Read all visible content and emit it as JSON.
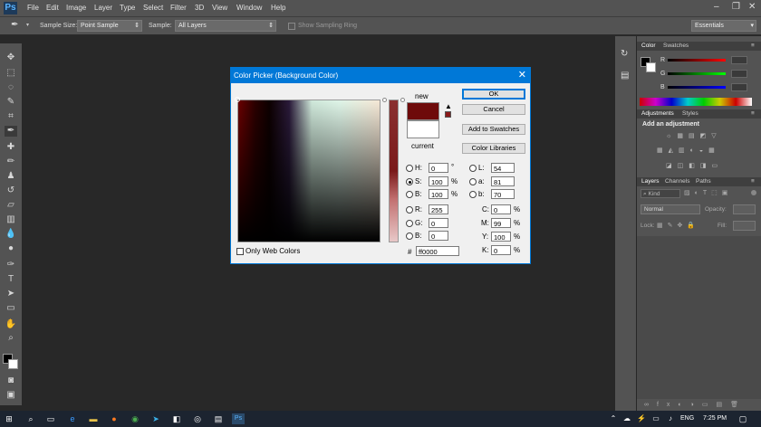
{
  "menubar": {
    "logo": "Ps",
    "items": [
      "File",
      "Edit",
      "Image",
      "Layer",
      "Type",
      "Select",
      "Filter",
      "3D",
      "View",
      "Window",
      "Help"
    ]
  },
  "options_bar": {
    "sample_size_label": "Sample Size:",
    "sample_size_value": "Point Sample",
    "sample_label": "Sample:",
    "sample_value": "All Layers",
    "show_ring_label": "Show Sampling Ring",
    "workspace_value": "Essentials"
  },
  "panels": {
    "color_tabs": [
      "Color",
      "Swatches"
    ],
    "color_channels": [
      "R",
      "G",
      "B"
    ],
    "adjust_tabs": [
      "Adjustments",
      "Styles"
    ],
    "add_adjustment": "Add an adjustment",
    "layers_tabs": [
      "Layers",
      "Channels",
      "Paths"
    ],
    "kind_label": "Kind",
    "blend_mode": "Normal",
    "opacity_label": "Opacity:",
    "lock_label": "Lock:",
    "fill_label": "Fill:"
  },
  "dialog": {
    "title": "Color Picker (Background Color)",
    "new_label": "new",
    "current_label": "current",
    "only_web_colors": "Only Web Colors",
    "buttons": {
      "ok": "OK",
      "cancel": "Cancel",
      "add_to_swatches": "Add to Swatches",
      "color_libraries": "Color Libraries"
    },
    "fields": {
      "H": {
        "label": "H:",
        "value": "0",
        "unit": "°"
      },
      "S": {
        "label": "S:",
        "value": "100",
        "unit": "%"
      },
      "B": {
        "label": "B:",
        "value": "100",
        "unit": "%"
      },
      "R": {
        "label": "R:",
        "value": "255"
      },
      "G": {
        "label": "G:",
        "value": "0"
      },
      "Bl": {
        "label": "B:",
        "value": "0"
      },
      "L": {
        "label": "L:",
        "value": "54"
      },
      "a": {
        "label": "a:",
        "value": "81"
      },
      "b": {
        "label": "b:",
        "value": "70"
      },
      "C": {
        "label": "C:",
        "value": "0",
        "unit": "%"
      },
      "M": {
        "label": "M:",
        "value": "99",
        "unit": "%"
      },
      "Y": {
        "label": "Y:",
        "value": "100",
        "unit": "%"
      },
      "K": {
        "label": "K:",
        "value": "0",
        "unit": "%"
      }
    },
    "hex_label": "#",
    "hex_value": "ff0000",
    "new_color": "#6e0a0a",
    "current_color": "#ffffff"
  },
  "taskbar": {
    "lang": "ENG",
    "time": "7:25 PM"
  },
  "colors": {
    "accent": "#0078d7",
    "panel": "#535353",
    "background": "#282828"
  }
}
